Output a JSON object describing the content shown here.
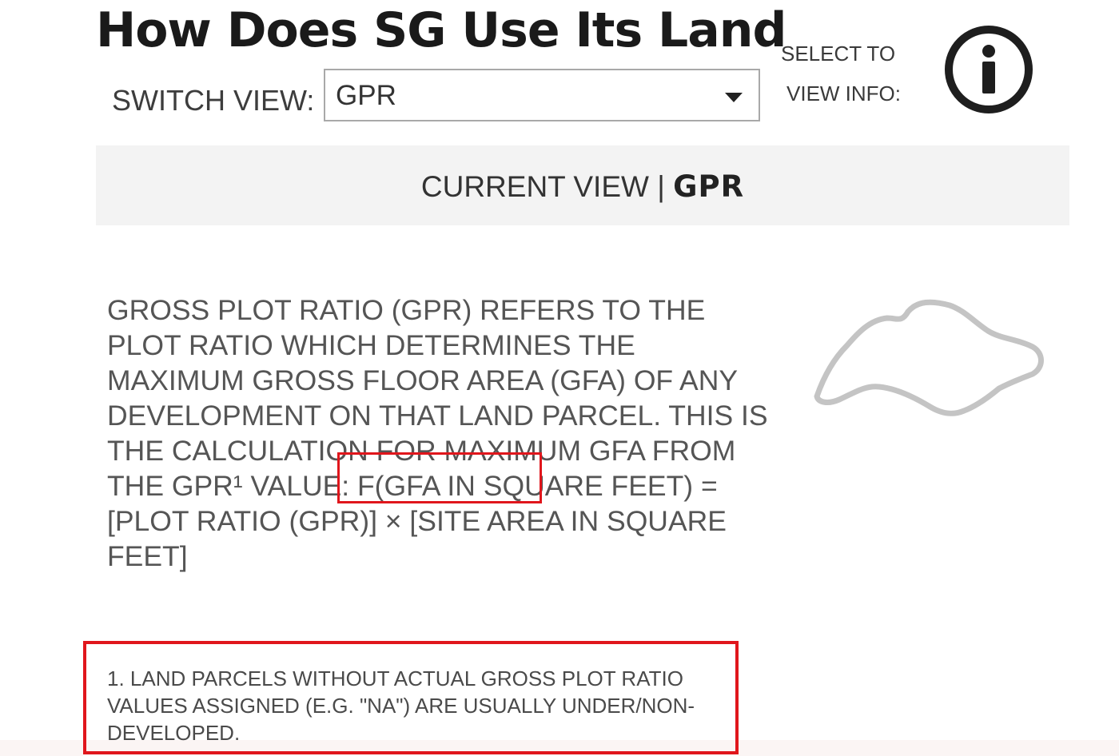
{
  "header": {
    "title": "How Does SG Use Its Land",
    "switch_view_label": "SWITCH VIEW:",
    "info_label_line1": "SELECT TO",
    "info_label_line2": "VIEW INFO:"
  },
  "view_select": {
    "selected": "GPR"
  },
  "current_view": {
    "prefix": "CURRENT VIEW |",
    "value": "GPR"
  },
  "description": {
    "text": "GROSS PLOT RATIO (GPR) REFERS TO THE PLOT RATIO WHICH DETERMINES THE MAXIMUM GROSS FLOOR AREA (GFA) OF ANY DEVELOPMENT ON THAT LAND PARCEL. THIS IS THE CALCULATION FOR MAXIMUM GFA FROM THE GPR¹ VALUE: F(GFA IN SQUARE FEET) = [PLOT RATIO (GPR)] × [SITE AREA IN SQUARE FEET]"
  },
  "footnote": {
    "text": "1. LAND PARCELS WITHOUT ACTUAL GROSS PLOT RATIO VALUES ASSIGNED (E.G. \"NA\") ARE USUALLY UNDER/NON-DEVELOPED."
  },
  "icons": {
    "info": "info-icon",
    "map": "singapore-map-outline-icon",
    "dropdown": "chevron-down-icon"
  },
  "colors": {
    "highlight": "#e0161c",
    "banner_background": "#f3f3f3",
    "map_outline": "#c4c4c4"
  }
}
